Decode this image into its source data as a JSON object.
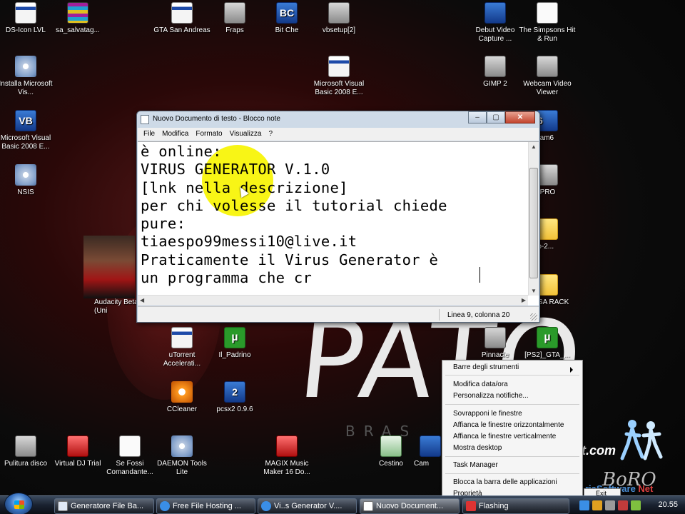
{
  "desktop": {
    "background": {
      "word": "PATO",
      "subword": "BRAS",
      "watermark": "BoRO",
      "site_text": "t.com",
      "site_text2_prefix": "ria",
      "site_text2_mid": "Software ",
      "site_text2_suffix": "Net"
    },
    "icons": [
      {
        "label": "DS-Icon LVL",
        "icon": "window-icon"
      },
      {
        "label": "sa_salvatag...",
        "icon": "archive-icon"
      },
      {
        "label": "GTA San Andreas",
        "icon": "window-icon"
      },
      {
        "label": "Fraps",
        "icon": "fraps-icon"
      },
      {
        "label": "Bit Che",
        "icon": "bitche-icon"
      },
      {
        "label": "vbsetup[2]",
        "icon": "setup-icon"
      },
      {
        "label": "Debut Video Capture ...",
        "icon": "video-capture-icon"
      },
      {
        "label": "The Simpsons Hit & Run",
        "icon": "simpsons-icon"
      },
      {
        "label": "Installa Microsoft Vis...",
        "icon": "installer-cd-icon"
      },
      {
        "label": "Microsoft Visual Basic 2008 E...",
        "icon": "window-icon"
      },
      {
        "label": "GIMP 2",
        "icon": "gimp-icon"
      },
      {
        "label": "Webcam Video Viewer",
        "icon": "webcam-icon"
      },
      {
        "label": "Microsoft Visual Basic 2008 E...",
        "icon": "vb-icon"
      },
      {
        "label": "stream6",
        "icon": "stream-icon"
      },
      {
        "label": "NSIS",
        "icon": "nsis-icon"
      },
      {
        "label": "DS PRO",
        "icon": "ds-pro-icon"
      },
      {
        "label": "udio-2...",
        "icon": "folder-icon"
      },
      {
        "label": "Audacity Beta (Uni",
        "icon": "audacity-icon"
      },
      {
        "label": "eo SA RACK",
        "icon": "folder-icon"
      },
      {
        "label": "uTorrent Accelerati...",
        "icon": "window-icon"
      },
      {
        "label": "Il_Padrino",
        "icon": "utorrent-icon"
      },
      {
        "label": "Pinnacle",
        "icon": "pinnacle-icon"
      },
      {
        "label": "[PS2]_GTA_...",
        "icon": "utorrent-icon"
      },
      {
        "label": "CCleaner",
        "icon": "ccleaner-icon"
      },
      {
        "label": "pcsx2 0.9.6",
        "icon": "pcsx2-icon"
      },
      {
        "label": "Pulitura disco",
        "icon": "disk-cleanup-icon"
      },
      {
        "label": "Virtual DJ Trial",
        "icon": "virtualdj-icon"
      },
      {
        "label": "Se Fossi Comandante...",
        "icon": "document-icon"
      },
      {
        "label": "DAEMON Tools Lite",
        "icon": "daemon-tools-icon"
      },
      {
        "label": "MAGIX Music Maker 16 Do...",
        "icon": "magix-icon"
      },
      {
        "label": "Cestino",
        "icon": "recycle-bin-icon"
      },
      {
        "label": "Cam",
        "icon": "camera-icon"
      }
    ]
  },
  "notepad": {
    "title": "Nuovo Documento di testo - Blocco note",
    "controls": {
      "minimize": "–",
      "maximize": "▢",
      "close": "✕"
    },
    "menu": [
      "File",
      "Modifica",
      "Formato",
      "Visualizza",
      "?"
    ],
    "content": "è online:\nVIRUS GENERATOR V.1.0\n[lnk nella descrizione]\nper chi volesse il tutorial chiede\npure:\ntiaespo99messi10@live.it\nPraticamente il Virus Generator è\nun programma che cr",
    "status": "Linea 9, colonna 20"
  },
  "context_menu": {
    "items": [
      {
        "label": "Barre degli strumenti",
        "submenu": true
      },
      {
        "label": "Modifica data/ora"
      },
      {
        "label": "Personalizza notifiche..."
      },
      {
        "label": "Sovrapponi le finestre"
      },
      {
        "label": "Affianca le finestre orizzontalmente"
      },
      {
        "label": "Affianca le finestre verticalmente"
      },
      {
        "label": "Mostra desktop"
      },
      {
        "label": "Task Manager"
      },
      {
        "label": "Blocca la barra delle applicazioni"
      },
      {
        "label": "Proprietà"
      }
    ],
    "exit_label": "Exit"
  },
  "taskbar": {
    "buttons": [
      {
        "label": "Generatore File Ba...",
        "icon": "window-icon"
      },
      {
        "label": "Free File Hosting ...",
        "icon": "ie-icon"
      },
      {
        "label": "Vi..s Generator V....",
        "icon": "ie-icon"
      },
      {
        "label": "Nuovo Document...",
        "icon": "notepad-icon"
      },
      {
        "label": "Flashing",
        "icon": "flashing-icon"
      }
    ],
    "clock": "20.55"
  }
}
